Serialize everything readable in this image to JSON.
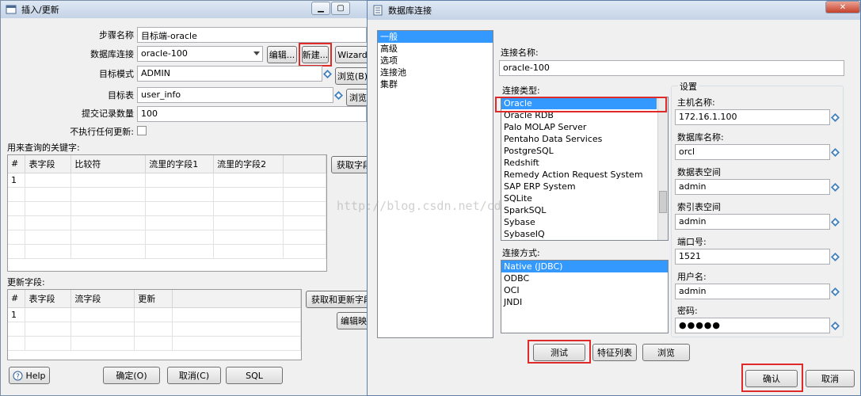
{
  "left_dialog": {
    "title": "插入/更新",
    "form": {
      "step_name_label": "步骤名称",
      "step_name_value": "目标端-oracle",
      "db_conn_label": "数据库连接",
      "db_conn_value": "oracle-100",
      "edit_button": "编辑...",
      "new_button": "新建...",
      "wizard_button": "Wizard",
      "target_schema_label": "目标模式",
      "target_schema_value": "ADMIN",
      "browse_schema_button": "浏览(B)",
      "target_table_label": "目标表",
      "target_table_value": "user_info",
      "browse_table_button": "浏览",
      "commit_size_label": "提交记录数量",
      "commit_size_value": "100",
      "no_update_label": "不执行任何更新:"
    },
    "keys_section": {
      "label": "用来查询的关键字:",
      "columns": [
        "#",
        "表字段",
        "比较符",
        "流里的字段1",
        "流里的字段2"
      ],
      "rows": [
        [
          "1",
          "",
          "",
          "",
          ""
        ]
      ],
      "get_fields_button": "获取字段"
    },
    "update_section": {
      "label": "更新字段:",
      "columns": [
        "#",
        "表字段",
        "流字段",
        "更新"
      ],
      "rows": [
        [
          "1",
          "",
          "",
          ""
        ]
      ],
      "get_update_button": "获取和更新字段",
      "edit_mapping_button": "编辑映射"
    },
    "footer": {
      "help_button": "Help",
      "ok_button": "确定(O)",
      "cancel_button": "取消(C)",
      "sql_button": "SQL"
    }
  },
  "right_dialog": {
    "title": "数据库连接",
    "nav_items": [
      "一般",
      "高级",
      "选项",
      "连接池",
      "集群"
    ],
    "nav_selected": 0,
    "conn_name_label": "连接名称:",
    "conn_name_value": "oracle-100",
    "conn_type_label": "连接类型:",
    "conn_types": [
      "Oracle",
      "Oracle RDB",
      "Palo MOLAP Server",
      "Pentaho Data Services",
      "PostgreSQL",
      "Redshift",
      "Remedy Action Request System",
      "SAP ERP System",
      "SQLite",
      "SparkSQL",
      "Sybase",
      "SybaseIQ"
    ],
    "conn_type_selected": 0,
    "access_label": "连接方式:",
    "access_types": [
      "Native (JDBC)",
      "ODBC",
      "OCI",
      "JNDI"
    ],
    "access_selected": 0,
    "settings": {
      "group_label": "设置",
      "host_label": "主机名称:",
      "host_value": "172.16.1.100",
      "db_name_label": "数据库名称:",
      "db_name_value": "orcl",
      "tablespace_label": "数据表空间",
      "tablespace_value": "admin",
      "index_tablespace_label": "索引表空间",
      "index_tablespace_value": "admin",
      "port_label": "端口号:",
      "port_value": "1521",
      "user_label": "用户名:",
      "user_value": "admin",
      "password_label": "密码:",
      "password_value": "●●●●●"
    },
    "test_button": "测试",
    "features_button": "特征列表",
    "browse_button": "浏览",
    "ok_button": "确认",
    "cancel_button": "取消"
  },
  "watermark": "http://blog.csdn.net/cd",
  "colors": {
    "highlight_red": "#e02a2a",
    "selection_blue": "#3399ff"
  },
  "icons": [
    "window-icon",
    "variable-diamond-icon",
    "help-icon",
    "dropdown-arrow-icon"
  ]
}
